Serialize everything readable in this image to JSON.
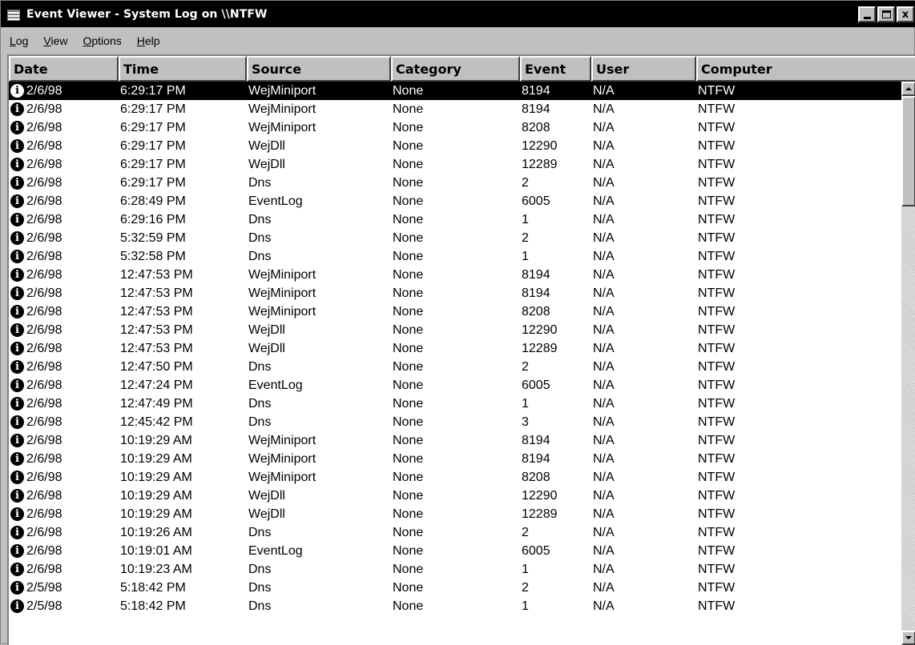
{
  "window": {
    "title": "Event Viewer - System Log on \\\\NTFW",
    "buttons": {
      "close": "x"
    }
  },
  "menu": [
    {
      "label": "Log",
      "accel": "L",
      "rest": "og"
    },
    {
      "label": "View",
      "accel": "V",
      "rest": "iew"
    },
    {
      "label": "Options",
      "accel": "O",
      "rest": "ptions"
    },
    {
      "label": "Help",
      "accel": "H",
      "rest": "elp"
    }
  ],
  "columns": {
    "date": "Date",
    "time": "Time",
    "source": "Source",
    "category": "Category",
    "event": "Event",
    "user": "User",
    "computer": "Computer"
  },
  "icon_glyph": "i",
  "rows": [
    {
      "date": "2/6/98",
      "time": "6:29:17 PM",
      "source": "WejMiniport",
      "category": "None",
      "event": "8194",
      "user": "N/A",
      "computer": "NTFW"
    },
    {
      "date": "2/6/98",
      "time": "6:29:17 PM",
      "source": "WejMiniport",
      "category": "None",
      "event": "8194",
      "user": "N/A",
      "computer": "NTFW"
    },
    {
      "date": "2/6/98",
      "time": "6:29:17 PM",
      "source": "WejMiniport",
      "category": "None",
      "event": "8208",
      "user": "N/A",
      "computer": "NTFW"
    },
    {
      "date": "2/6/98",
      "time": "6:29:17 PM",
      "source": "WejDll",
      "category": "None",
      "event": "12290",
      "user": "N/A",
      "computer": "NTFW"
    },
    {
      "date": "2/6/98",
      "time": "6:29:17 PM",
      "source": "WejDll",
      "category": "None",
      "event": "12289",
      "user": "N/A",
      "computer": "NTFW"
    },
    {
      "date": "2/6/98",
      "time": "6:29:17 PM",
      "source": "Dns",
      "category": "None",
      "event": "2",
      "user": "N/A",
      "computer": "NTFW"
    },
    {
      "date": "2/6/98",
      "time": "6:28:49 PM",
      "source": "EventLog",
      "category": "None",
      "event": "6005",
      "user": "N/A",
      "computer": "NTFW"
    },
    {
      "date": "2/6/98",
      "time": "6:29:16 PM",
      "source": "Dns",
      "category": "None",
      "event": "1",
      "user": "N/A",
      "computer": "NTFW"
    },
    {
      "date": "2/6/98",
      "time": "5:32:59 PM",
      "source": "Dns",
      "category": "None",
      "event": "2",
      "user": "N/A",
      "computer": "NTFW"
    },
    {
      "date": "2/6/98",
      "time": "5:32:58 PM",
      "source": "Dns",
      "category": "None",
      "event": "1",
      "user": "N/A",
      "computer": "NTFW"
    },
    {
      "date": "2/6/98",
      "time": "12:47:53 PM",
      "source": "WejMiniport",
      "category": "None",
      "event": "8194",
      "user": "N/A",
      "computer": "NTFW"
    },
    {
      "date": "2/6/98",
      "time": "12:47:53 PM",
      "source": "WejMiniport",
      "category": "None",
      "event": "8194",
      "user": "N/A",
      "computer": "NTFW"
    },
    {
      "date": "2/6/98",
      "time": "12:47:53 PM",
      "source": "WejMiniport",
      "category": "None",
      "event": "8208",
      "user": "N/A",
      "computer": "NTFW"
    },
    {
      "date": "2/6/98",
      "time": "12:47:53 PM",
      "source": "WejDll",
      "category": "None",
      "event": "12290",
      "user": "N/A",
      "computer": "NTFW"
    },
    {
      "date": "2/6/98",
      "time": "12:47:53 PM",
      "source": "WejDll",
      "category": "None",
      "event": "12289",
      "user": "N/A",
      "computer": "NTFW"
    },
    {
      "date": "2/6/98",
      "time": "12:47:50 PM",
      "source": "Dns",
      "category": "None",
      "event": "2",
      "user": "N/A",
      "computer": "NTFW"
    },
    {
      "date": "2/6/98",
      "time": "12:47:24 PM",
      "source": "EventLog",
      "category": "None",
      "event": "6005",
      "user": "N/A",
      "computer": "NTFW"
    },
    {
      "date": "2/6/98",
      "time": "12:47:49 PM",
      "source": "Dns",
      "category": "None",
      "event": "1",
      "user": "N/A",
      "computer": "NTFW"
    },
    {
      "date": "2/6/98",
      "time": "12:45:42 PM",
      "source": "Dns",
      "category": "None",
      "event": "3",
      "user": "N/A",
      "computer": "NTFW"
    },
    {
      "date": "2/6/98",
      "time": "10:19:29 AM",
      "source": "WejMiniport",
      "category": "None",
      "event": "8194",
      "user": "N/A",
      "computer": "NTFW"
    },
    {
      "date": "2/6/98",
      "time": "10:19:29 AM",
      "source": "WejMiniport",
      "category": "None",
      "event": "8194",
      "user": "N/A",
      "computer": "NTFW"
    },
    {
      "date": "2/6/98",
      "time": "10:19:29 AM",
      "source": "WejMiniport",
      "category": "None",
      "event": "8208",
      "user": "N/A",
      "computer": "NTFW"
    },
    {
      "date": "2/6/98",
      "time": "10:19:29 AM",
      "source": "WejDll",
      "category": "None",
      "event": "12290",
      "user": "N/A",
      "computer": "NTFW"
    },
    {
      "date": "2/6/98",
      "time": "10:19:29 AM",
      "source": "WejDll",
      "category": "None",
      "event": "12289",
      "user": "N/A",
      "computer": "NTFW"
    },
    {
      "date": "2/6/98",
      "time": "10:19:26 AM",
      "source": "Dns",
      "category": "None",
      "event": "2",
      "user": "N/A",
      "computer": "NTFW"
    },
    {
      "date": "2/6/98",
      "time": "10:19:01 AM",
      "source": "EventLog",
      "category": "None",
      "event": "6005",
      "user": "N/A",
      "computer": "NTFW"
    },
    {
      "date": "2/6/98",
      "time": "10:19:23 AM",
      "source": "Dns",
      "category": "None",
      "event": "1",
      "user": "N/A",
      "computer": "NTFW"
    },
    {
      "date": "2/5/98",
      "time": "5:18:42 PM",
      "source": "Dns",
      "category": "None",
      "event": "2",
      "user": "N/A",
      "computer": "NTFW"
    },
    {
      "date": "2/5/98",
      "time": "5:18:42 PM",
      "source": "Dns",
      "category": "None",
      "event": "1",
      "user": "N/A",
      "computer": "NTFW"
    }
  ],
  "selected_row": 0
}
